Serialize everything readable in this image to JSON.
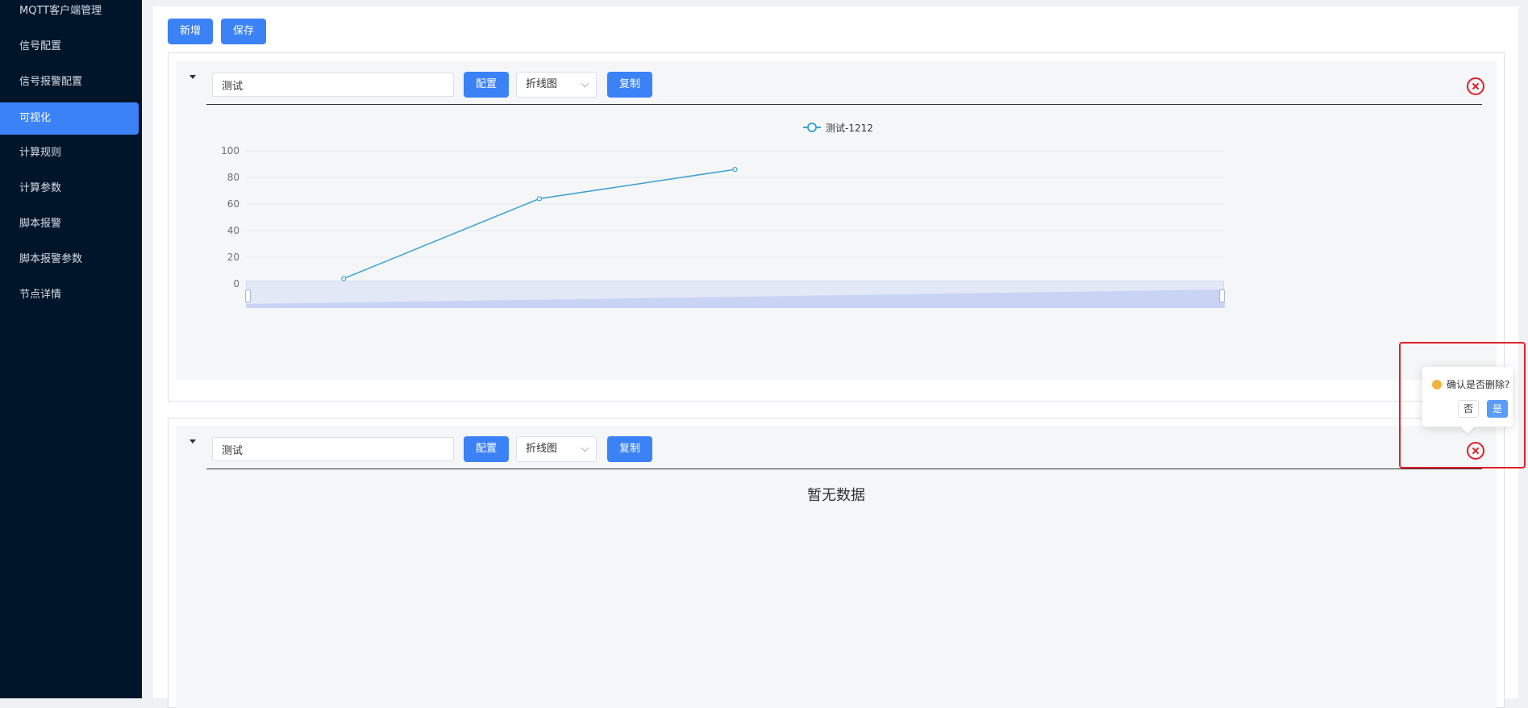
{
  "sidebar": {
    "items": [
      {
        "label": "MQTT客户端管理",
        "active": false
      },
      {
        "label": "信号配置",
        "active": false
      },
      {
        "label": "信号报警配置",
        "active": false
      },
      {
        "label": "可视化",
        "active": true
      },
      {
        "label": "计算规则",
        "active": false
      },
      {
        "label": "计算参数",
        "active": false
      },
      {
        "label": "脚本报警",
        "active": false
      },
      {
        "label": "脚本报警参数",
        "active": false
      },
      {
        "label": "节点详情",
        "active": false
      }
    ]
  },
  "toolbar": {
    "add_label": "新增",
    "save_label": "保存"
  },
  "panels": [
    {
      "name_value": "测试",
      "config_label": "配置",
      "chart_type": "折线图",
      "copy_label": "复制"
    },
    {
      "name_value": "测试",
      "config_label": "配置",
      "chart_type": "折线图",
      "copy_label": "复制",
      "empty_text": "暂无数据"
    }
  ],
  "colors": {
    "accent": "#3b82f6",
    "series": "#3aa3d2",
    "danger": "#e0202a",
    "sidebar": "#001529"
  },
  "chart_data": {
    "type": "line",
    "series": [
      {
        "name": "测试-1212",
        "values": [
          4,
          64,
          86
        ]
      }
    ],
    "y_ticks": [
      "0",
      "20",
      "40",
      "60",
      "80",
      "100"
    ],
    "ylim": [
      0,
      100
    ],
    "legend": "top-center",
    "grid": true,
    "datazoom_slider": true
  },
  "popconfirm": {
    "message": "确认是否删除?",
    "no_label": "否",
    "yes_label": "是"
  }
}
